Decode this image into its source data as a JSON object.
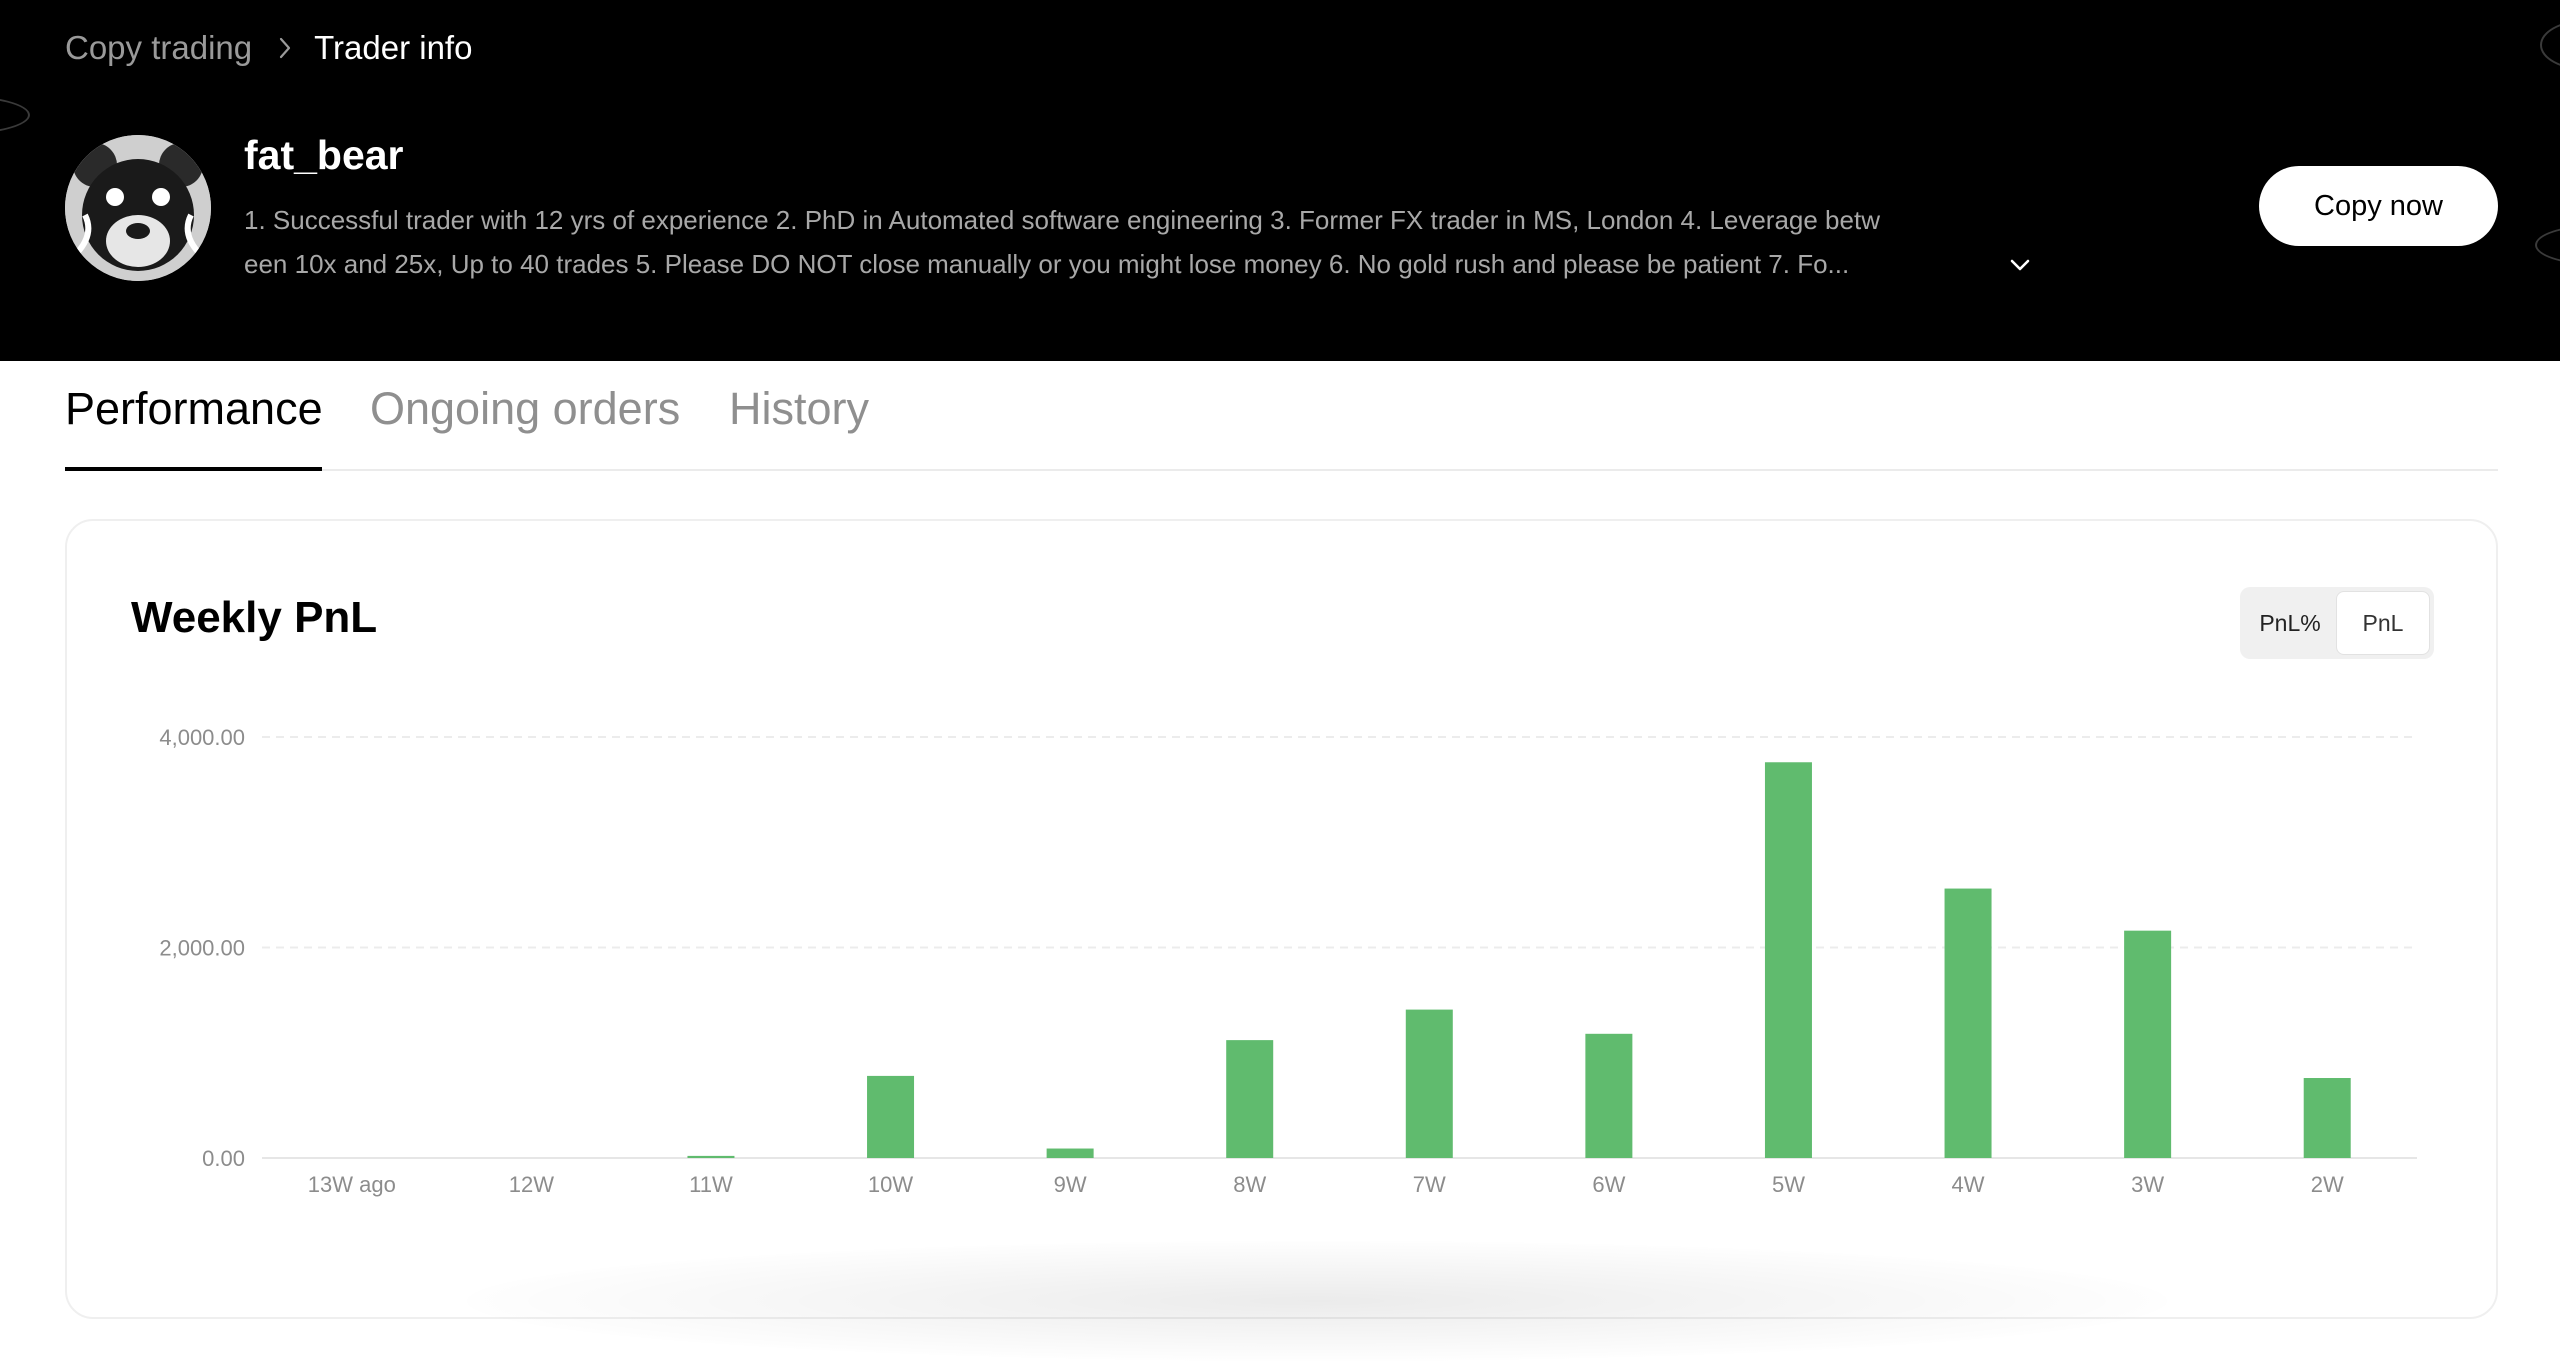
{
  "breadcrumb": {
    "parent": "Copy trading",
    "current": "Trader info"
  },
  "trader": {
    "name": "fat_bear",
    "bio_line1": "1. Successful trader with 12 yrs of experience 2. PhD in Automated software engineering 3. Former FX trader in MS, London 4. Leverage betw",
    "bio_line2": "een 10x and 25x, Up to 40 trades 5. Please DO NOT close manually or you might lose money 6. No gold rush and please be patient 7. Fo..."
  },
  "actions": {
    "copy_label": "Copy now"
  },
  "tabs": [
    {
      "label": "Performance",
      "active": true
    },
    {
      "label": "Ongoing orders",
      "active": false
    },
    {
      "label": "History",
      "active": false
    }
  ],
  "pnl_card": {
    "title": "Weekly PnL",
    "toggle": [
      {
        "label": "PnL%",
        "selected": false
      },
      {
        "label": "PnL",
        "selected": true
      }
    ]
  },
  "colors": {
    "bar": "#60bb6e",
    "hero_bg": "#000000",
    "text_muted": "#9a9a9a"
  },
  "chart_data": {
    "type": "bar",
    "categories": [
      "13W ago",
      "12W",
      "11W",
      "10W",
      "9W",
      "8W",
      "7W",
      "6W",
      "5W",
      "4W",
      "3W",
      "2W"
    ],
    "values": [
      0,
      0,
      20,
      780,
      90,
      1120,
      1410,
      1180,
      3760,
      2560,
      2160,
      760
    ],
    "ylim": [
      0,
      4000
    ],
    "yticks": [
      0,
      2000,
      4000
    ],
    "ytick_labels": [
      "0.00",
      "2,000.00",
      "4,000.00"
    ],
    "grid": "horizontal dashed",
    "legend": "none"
  }
}
